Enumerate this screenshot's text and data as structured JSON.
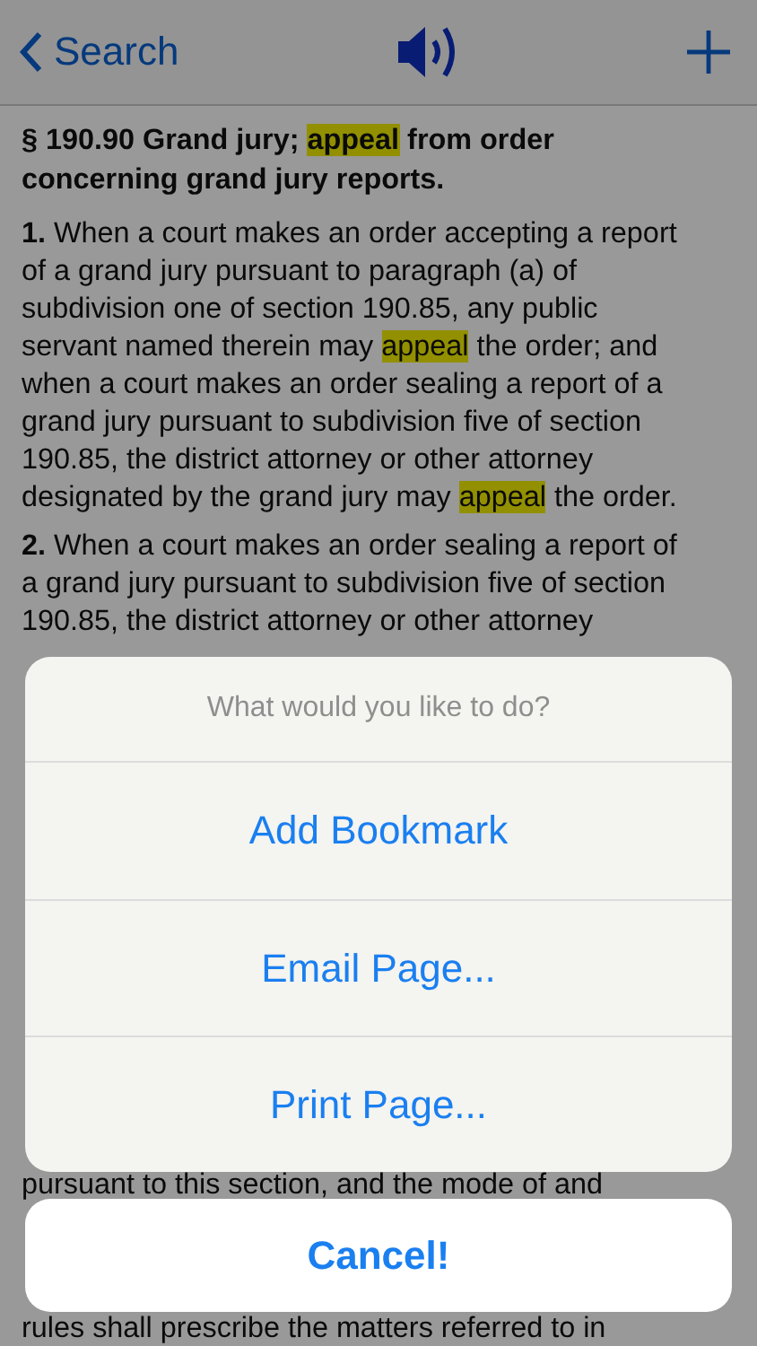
{
  "nav_bar": {
    "back_label": "Search"
  },
  "heading": [
    [
      {
        "text": "§ 190.90 Grand jury; ",
        "highlighted": false
      },
      {
        "text": "appeal",
        "highlighted": true
      },
      {
        "text": " from order",
        "highlighted": false
      }
    ],
    [
      {
        "text": "concerning grand jury reports.",
        "highlighted": false
      }
    ]
  ],
  "paragraphs": [
    {
      "number": "1.",
      "lines": [
        [
          {
            "text": "When a court makes an order accepting a report",
            "highlighted": false
          }
        ],
        [
          {
            "text": "of a grand jury pursuant to paragraph (a) of",
            "highlighted": false
          }
        ],
        [
          {
            "text": "subdivision one of section 190.85, any public",
            "highlighted": false
          }
        ],
        [
          {
            "text": "servant named therein may ",
            "highlighted": false
          },
          {
            "text": "appeal",
            "highlighted": true
          },
          {
            "text": " the order; and",
            "highlighted": false
          }
        ],
        [
          {
            "text": "when a court makes an order sealing a report of a",
            "highlighted": false
          }
        ],
        [
          {
            "text": "grand jury pursuant to subdivision five of section",
            "highlighted": false
          }
        ],
        [
          {
            "text": "190.85, the district attorney or other attorney",
            "highlighted": false
          }
        ],
        [
          {
            "text": "designated by the grand jury may ",
            "highlighted": false
          },
          {
            "text": "appeal",
            "highlighted": true
          },
          {
            "text": " the order.",
            "highlighted": false
          }
        ]
      ]
    },
    {
      "number": "2.",
      "lines": [
        [
          {
            "text": "When a court makes an order sealing a report of",
            "highlighted": false
          }
        ],
        [
          {
            "text": "a grand jury pursuant to subdivision five of section",
            "highlighted": false
          }
        ],
        [
          {
            "text": "190.85, the district attorney or other attorney",
            "highlighted": false
          }
        ]
      ]
    }
  ],
  "visible_lines_below": [
    "pursuant to this section, and the mode of and",
    "rules shall prescribe the matters referred to in"
  ],
  "action_sheet": {
    "title": "What would you like to do?",
    "actions": [
      "Add Bookmark",
      "Email Page...",
      "Print Page..."
    ],
    "cancel": "Cancel!"
  }
}
